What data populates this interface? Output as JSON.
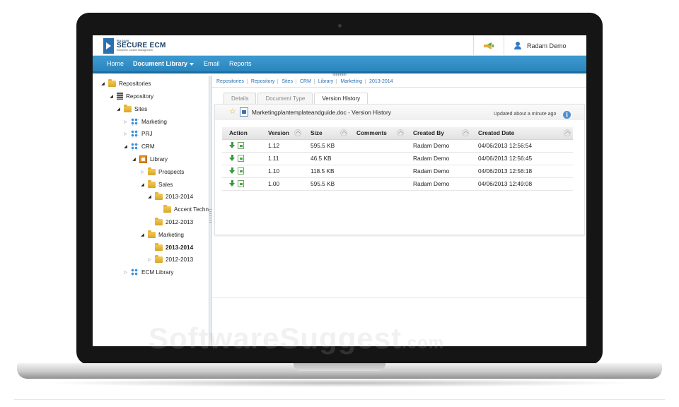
{
  "app": {
    "logo_small": "RADAM",
    "logo_title": "SECURE ECM",
    "logo_subtitle": "Enterprise Content Management",
    "user_name": "Radam Demo"
  },
  "nav": {
    "home": "Home",
    "document_library": "Document Library",
    "email": "Email",
    "reports": "Reports"
  },
  "tree": [
    {
      "label": "Repositories",
      "state": "open",
      "icon": "folder-icon"
    },
    {
      "label": "Repository",
      "state": "open",
      "icon": "repository-icon"
    },
    {
      "label": "Sites",
      "state": "open",
      "icon": "folder-icon"
    },
    {
      "label": "Marketing",
      "state": "closed",
      "icon": "site-icon"
    },
    {
      "label": "PRJ",
      "state": "closed",
      "icon": "site-icon"
    },
    {
      "label": "CRM",
      "state": "open",
      "icon": "site-icon"
    },
    {
      "label": "Library",
      "state": "open",
      "icon": "library-icon"
    },
    {
      "label": "Prospects",
      "state": "closed",
      "icon": "folder-icon"
    },
    {
      "label": "Sales",
      "state": "open",
      "icon": "folder-icon"
    },
    {
      "label": "2013-2014",
      "state": "open",
      "icon": "folder-icon"
    },
    {
      "label": "Accent Techno",
      "state": "leaf",
      "icon": "folder-icon"
    },
    {
      "label": "2012-2013",
      "state": "leaf",
      "icon": "folder-icon"
    },
    {
      "label": "Marketing",
      "state": "open",
      "icon": "folder-icon"
    },
    {
      "label": "2013-2014",
      "state": "leaf",
      "icon": "folder-icon",
      "selected": true
    },
    {
      "label": "2012-2013",
      "state": "closed",
      "icon": "folder-icon"
    },
    {
      "label": "ECM Library",
      "state": "closed",
      "icon": "site-icon"
    }
  ],
  "breadcrumb": [
    "Repositories",
    "Repository",
    "Sites",
    "CRM",
    "Library",
    "Marketing",
    "2013-2014"
  ],
  "tabs": [
    "Details",
    "Document Type",
    "Version History"
  ],
  "active_tab": "Version History",
  "document": {
    "title": "Marketingplantemplateandguide.doc - Version History",
    "updated": "Updated about a minute ago",
    "info_icon": "i"
  },
  "version_table": {
    "columns": [
      "Action",
      "Version",
      "Size",
      "Comments",
      "Created By",
      "Created Date"
    ],
    "rows": [
      {
        "version": "1.12",
        "size": "595.5 KB",
        "comments": "",
        "created_by": "Radam Demo",
        "created_date": "04/06/2013 12:56:54"
      },
      {
        "version": "1.11",
        "size": "46.5 KB",
        "comments": "",
        "created_by": "Radam Demo",
        "created_date": "04/06/2013 12:56:45"
      },
      {
        "version": "1.10",
        "size": "118.5 KB",
        "comments": "",
        "created_by": "Radam Demo",
        "created_date": "04/06/2013 12:56:18"
      },
      {
        "version": "1.00",
        "size": "595.5 KB",
        "comments": "",
        "created_by": "Radam Demo",
        "created_date": "04/06/2013 12:49:08"
      }
    ]
  },
  "watermark": {
    "main": "SoftwareSuggest",
    "suffix": ".com"
  },
  "colors": {
    "nav_blue": "#2b85bd",
    "link_blue": "#2a6fb0",
    "folder_yellow": "#e8b43d"
  }
}
